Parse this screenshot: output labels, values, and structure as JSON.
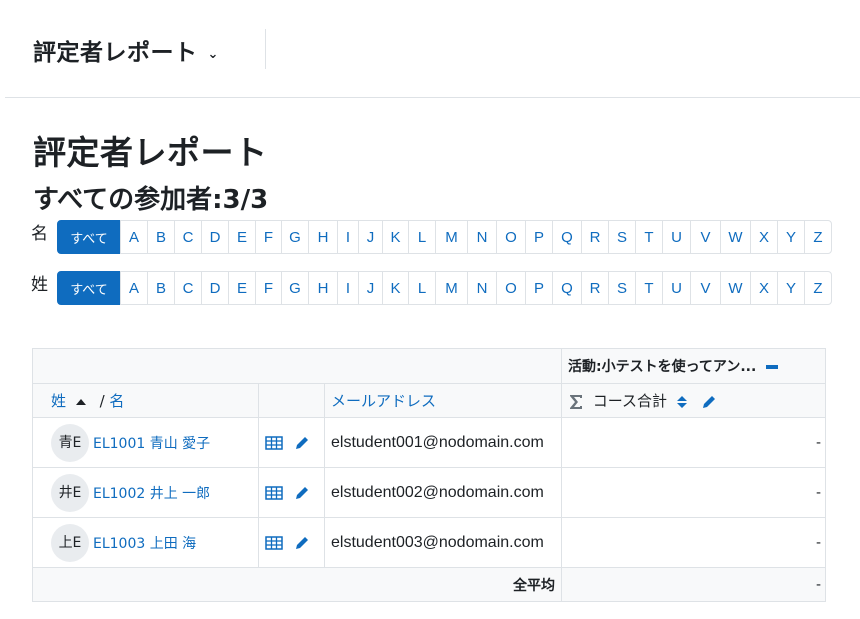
{
  "report_selector": {
    "label": "評定者レポート",
    "chevron": "⌄"
  },
  "page_title": "評定者レポート",
  "participants": "すべての参加者:3/3",
  "initials_first": {
    "label": "名",
    "all": "すべて",
    "letters": [
      "A",
      "B",
      "C",
      "D",
      "E",
      "F",
      "G",
      "H",
      "I",
      "J",
      "K",
      "L",
      "M",
      "N",
      "O",
      "P",
      "Q",
      "R",
      "S",
      "T",
      "U",
      "V",
      "W",
      "X",
      "Y",
      "Z"
    ]
  },
  "initials_last": {
    "label": "姓",
    "all": "すべて",
    "letters": [
      "A",
      "B",
      "C",
      "D",
      "E",
      "F",
      "G",
      "H",
      "I",
      "J",
      "K",
      "L",
      "M",
      "N",
      "O",
      "P",
      "Q",
      "R",
      "S",
      "T",
      "U",
      "V",
      "W",
      "X",
      "Y",
      "Z"
    ]
  },
  "table": {
    "category": "活動:小テストを使ってアン...",
    "col_lastname": "姓",
    "col_sep": "/",
    "col_firstname": "名",
    "col_email": "メールアドレス",
    "col_total": "コース合計",
    "rows": [
      {
        "avatar": "青E",
        "name": "EL1001 青山 愛子",
        "email": "elstudent001@nodomain.com",
        "total": "-"
      },
      {
        "avatar": "井E",
        "name": "EL1002 井上 一郎",
        "email": "elstudent002@nodomain.com",
        "total": "-"
      },
      {
        "avatar": "上E",
        "name": "EL1003 上田 海",
        "email": "elstudent003@nodomain.com",
        "total": "-"
      }
    ],
    "overall_label": "全平均",
    "overall_value": "-"
  },
  "colors": {
    "accent": "#0f6cbf",
    "border": "#dee2e6",
    "header_bg": "#f8f9fa"
  },
  "icons": [
    "chevron-down-icon",
    "sort-asc-icon",
    "sigma-icon",
    "sort-both-icon",
    "pencil-icon",
    "grid-icon",
    "collapse-icon"
  ]
}
